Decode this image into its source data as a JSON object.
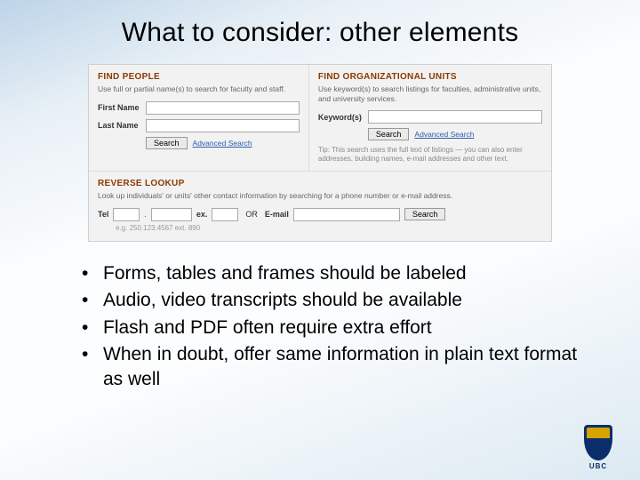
{
  "title": "What to consider: other elements",
  "form": {
    "findPeople": {
      "header": "FIND PEOPLE",
      "desc": "Use full or partial name(s) to search for faculty and staff.",
      "firstNameLabel": "First Name",
      "lastNameLabel": "Last Name",
      "searchBtn": "Search",
      "advLink": "Advanced Search"
    },
    "findOrg": {
      "header": "FIND ORGANIZATIONAL UNITS",
      "desc": "Use keyword(s) to search listings for faculties, administrative units, and university services.",
      "keywordLabel": "Keyword(s)",
      "searchBtn": "Search",
      "advLink": "Advanced Search",
      "tip": "Tip: This search uses the full text of listings — you can also enter addresses, building names, e-mail addresses and other text."
    },
    "reverse": {
      "header": "REVERSE LOOKUP",
      "desc": "Look up individuals' or units' other contact information by searching for a phone number or e-mail address.",
      "telLabel": "Tel",
      "extLabel": "ex.",
      "or": "OR",
      "emailLabel": "E-mail",
      "searchBtn": "Search",
      "eg": "e.g. 250.123.4567 ext. 890"
    }
  },
  "bullets": [
    "Forms, tables and frames should be labeled",
    "Audio, video transcripts should be available",
    "Flash and PDF often require extra effort",
    "When in doubt, offer same information in plain text format as well"
  ],
  "logo": {
    "text": "UBC"
  }
}
